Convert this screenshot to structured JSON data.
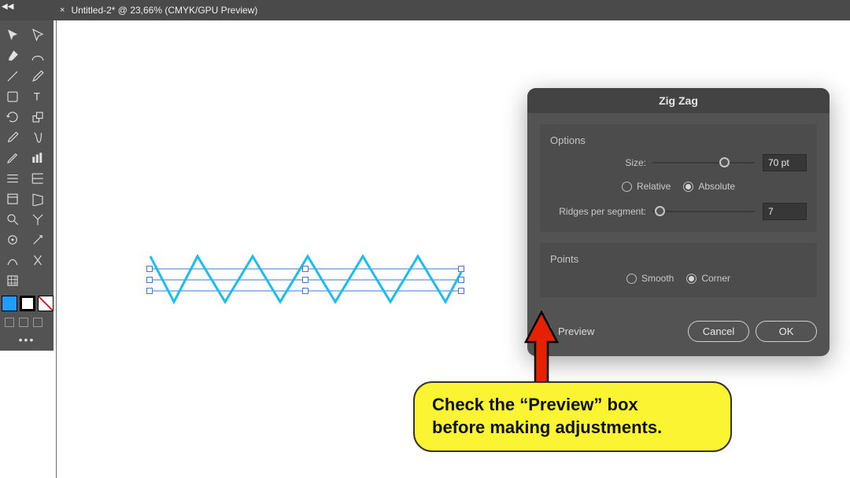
{
  "topbar": {
    "close_glyph": "×",
    "title": "Untitled-2* @ 23,66% (CMYK/GPU Preview)"
  },
  "tools": {
    "col1": [
      "selection",
      "paintbrush",
      "line",
      "shape",
      "rotate",
      "eyedropper",
      "pencil",
      "area-graph",
      "mesh",
      "magnifier",
      "puppet",
      "live-paint",
      "artboard"
    ],
    "col2": [
      "direct-select",
      "curvature",
      "pen",
      "type",
      "scale",
      "warp",
      "blob-brush",
      "column-graph",
      "gradient",
      "hand",
      "symbol-sprayer",
      "shape-builder",
      "slice"
    ]
  },
  "dialog": {
    "title": "Zig Zag",
    "options_head": "Options",
    "size_label": "Size:",
    "size_value": "70 pt",
    "rel_label": "Relative",
    "abs_label": "Absolute",
    "ridges_label": "Ridges per segment:",
    "ridges_value": "7",
    "points_head": "Points",
    "smooth_label": "Smooth",
    "corner_label": "Corner",
    "preview_label": "Preview",
    "cancel": "Cancel",
    "ok": "OK"
  },
  "callout": {
    "line1": "Check the “Preview” box",
    "line2": "before making adjustments."
  }
}
